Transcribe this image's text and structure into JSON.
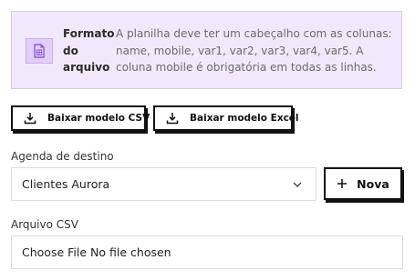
{
  "info": {
    "icon": "spreadsheet-doc-icon",
    "title": "Formato do arquivo",
    "text": "A planilha deve ter um cabeçalho com as colunas: name, mobile, var1, var2, var3, var4, var5. A coluna mobile é obrigatória em todas as linhas.",
    "background": "#f1e9fb",
    "accent": "#8a5cd6"
  },
  "downloads": {
    "csv_label": "Baixar modelo CSV",
    "excel_label": "Baixar modelo Excel",
    "icon": "download-icon"
  },
  "agenda": {
    "label": "Agenda de destino",
    "selected": "Clientes Aurora",
    "new_button_label": "Nova",
    "new_icon": "plus-icon"
  },
  "arquivo": {
    "label": "Arquivo CSV",
    "choose_label": "Choose File",
    "status": "No file chosen"
  }
}
